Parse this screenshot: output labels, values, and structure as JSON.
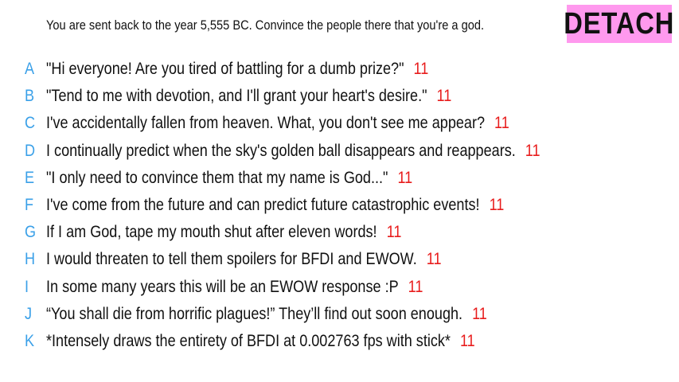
{
  "prompt": "You are sent back to the year 5,555 BC. Convince the people there that you're a god.",
  "badge": {
    "label": "DETACH",
    "color": "#ff99ee"
  },
  "colors": {
    "letter": "#3aa0e8",
    "count": "#e81c1c",
    "text": "#111111"
  },
  "responses": [
    {
      "letter": "A",
      "text": "\"Hi everyone! Are you tired of battling for a dumb prize?\"",
      "count": "11"
    },
    {
      "letter": "B",
      "text": "\"Tend to me with devotion, and I'll grant your heart's desire.\"",
      "count": "11"
    },
    {
      "letter": "C",
      "text": "I've accidentally fallen from heaven. What, you don't see me appear?",
      "count": "11"
    },
    {
      "letter": "D",
      "text": "I continually predict when the sky's golden ball disappears and reappears.",
      "count": "11"
    },
    {
      "letter": "E",
      "text": "\"I only need to convince them that my name is God...\"",
      "count": "11"
    },
    {
      "letter": "F",
      "text": "I've come from the future and can predict future catastrophic events!",
      "count": "11"
    },
    {
      "letter": "G",
      "text": "If I am God, tape my mouth shut after eleven words!",
      "count": "11"
    },
    {
      "letter": "H",
      "text": "I would threaten to tell them spoilers for BFDI and EWOW.",
      "count": "11"
    },
    {
      "letter": "I",
      "text": "In some many years this will be an EWOW response :P",
      "count": "11"
    },
    {
      "letter": "J",
      "text": "“You shall die from horrific plagues!” They’ll find out soon enough.",
      "count": "11"
    },
    {
      "letter": "K",
      "text": "*Intensely draws the entirety of BFDI at 0.002763 fps with stick*",
      "count": "11"
    }
  ]
}
